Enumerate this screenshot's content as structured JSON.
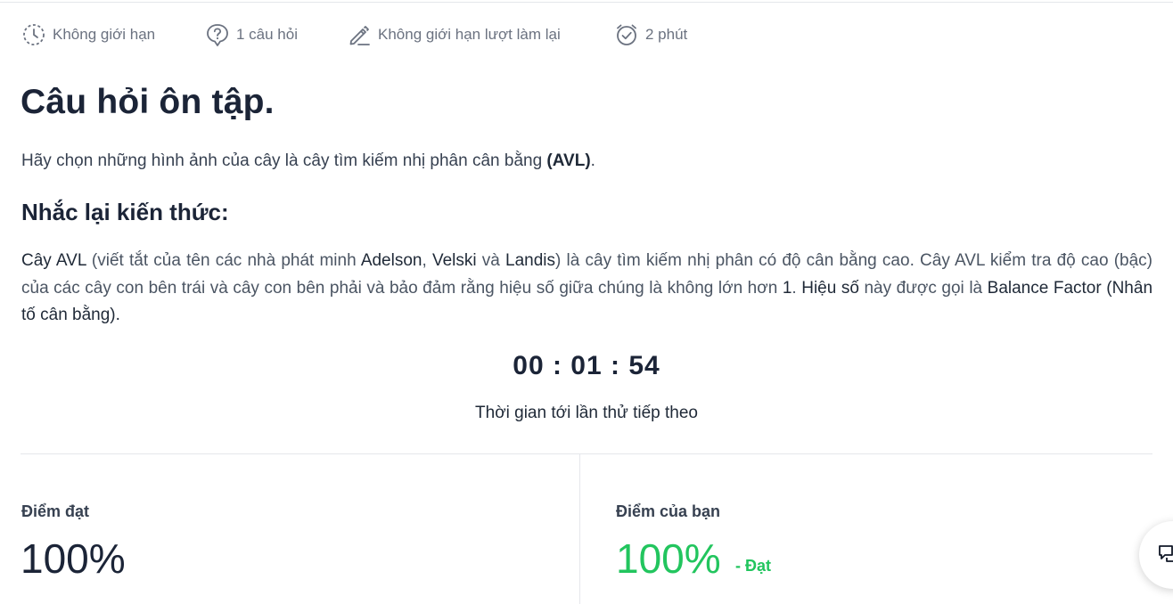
{
  "meta": {
    "attempts": "Không giới hạn",
    "questions": "1 câu hỏi",
    "retakes": "Không giới hạn lượt làm lại",
    "duration": "2 phút"
  },
  "title": "Câu hỏi ôn tập.",
  "instruction": {
    "text": "Hãy chọn những hình ảnh của cây là cây tìm kiếm nhị phân cân bằng ",
    "emphasis": "(AVL)",
    "end": "."
  },
  "recap_heading": "Nhắc lại kiến thức:",
  "recap": {
    "p1": "Cây AVL",
    "p2": " (viết tắt của tên các nhà phát minh ",
    "p3": "Adelson",
    "p4": ", ",
    "p5": "Velski",
    "p6": " và ",
    "p7": "Landis",
    "p8": ") là cây tìm kiếm nhị phân có độ cân bằng cao. Cây AVL kiểm tra độ cao (bậc) của các cây con bên trái và cây con bên phải và bảo đảm rằng hiệu số giữa chúng là không lớn hơn ",
    "p9": "1",
    "p10": ". ",
    "p11": "Hiệu số",
    "p12": " này được gọi là ",
    "p13": "Balance Factor",
    "p14": " (Nhân tố cân bằng)."
  },
  "timer": {
    "value": "00 : 01 : 54",
    "caption": "Thời gian tới lần thử tiếp theo"
  },
  "scores": {
    "required_label": "Điểm đạt",
    "required_value": "100%",
    "yours_label": "Điểm của bạn",
    "yours_value": "100%",
    "status": "- Đạt"
  },
  "colors": {
    "pass": "#22c55e",
    "heading": "#1b2437",
    "meta": "#6b7280"
  },
  "icons": {
    "attempts": "clock-dashed-icon",
    "questions": "question-bubble-icon",
    "retakes": "pencil-icon",
    "duration": "alarm-check-icon",
    "floating": "chat-icon"
  }
}
